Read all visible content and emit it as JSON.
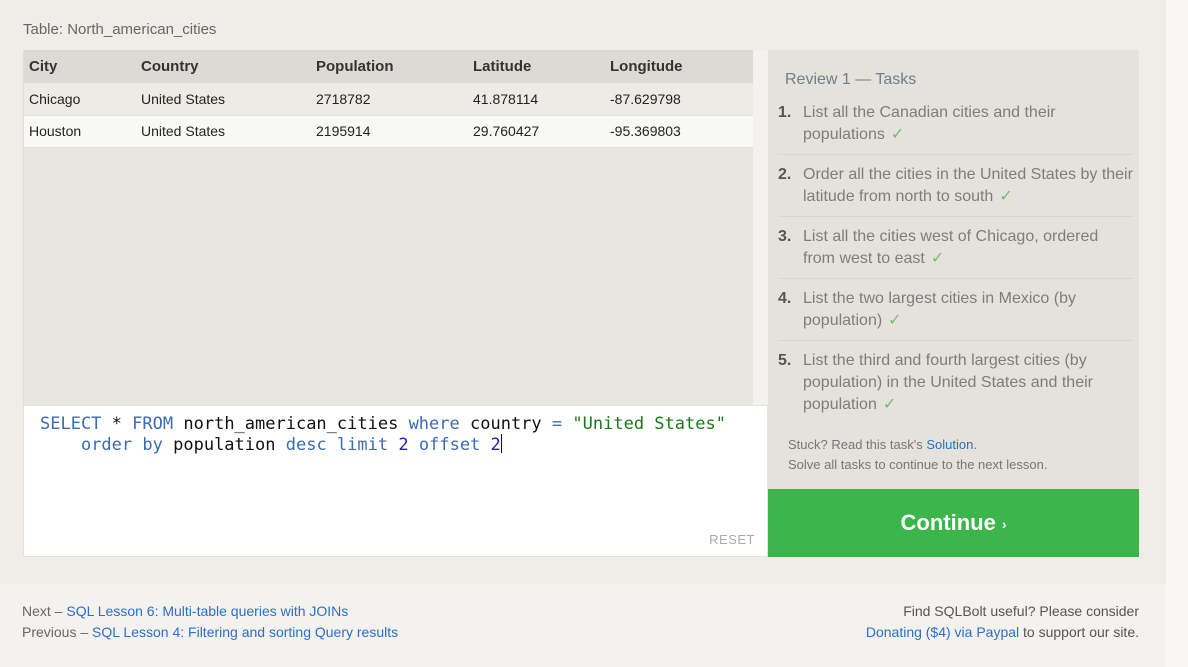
{
  "table": {
    "label": "Table: North_american_cities",
    "columns": [
      "City",
      "Country",
      "Population",
      "Latitude",
      "Longitude"
    ],
    "rows": [
      [
        "Chicago",
        "United States",
        "2718782",
        "41.878114",
        "-87.629798"
      ],
      [
        "Houston",
        "United States",
        "2195914",
        "29.760427",
        "-95.369803"
      ]
    ]
  },
  "editor": {
    "line1": {
      "kw_select": "SELECT",
      "star": "*",
      "kw_from": "FROM",
      "table": "north_american_cities",
      "kw_where": "where",
      "col": "country",
      "eq": "=",
      "value": "\"United States\""
    },
    "line2": {
      "kw_order": "order",
      "kw_by": "by",
      "col": "population",
      "kw_desc": "desc",
      "kw_limit": "limit",
      "limit": "2",
      "kw_offset": "offset",
      "offset": "2"
    },
    "reset_label": "RESET"
  },
  "tasks": {
    "title": "Review 1 — Tasks",
    "check": "✓",
    "items": [
      {
        "num": "1.",
        "text": "List all the Canadian cities and their populations"
      },
      {
        "num": "2.",
        "text": "Order all the cities in the United States by their latitude from north to south"
      },
      {
        "num": "3.",
        "text": "List all the cities west of Chicago, ordered from west to east"
      },
      {
        "num": "4.",
        "text": "List the two largest cities in Mexico (by population)"
      },
      {
        "num": "5.",
        "text": "List the third and fourth largest cities (by population) in the United States and their population"
      }
    ],
    "stuck_prefix": "Stuck? Read this task's ",
    "stuck_link": "Solution",
    "stuck_suffix": ".",
    "solve_note": "Solve all tasks to continue to the next lesson."
  },
  "continue_label": "Continue",
  "continue_chevron": "›",
  "footer": {
    "next_prefix": "Next – ",
    "next_link": "SQL Lesson 6: Multi-table queries with JOINs",
    "prev_prefix": "Previous – ",
    "prev_link": "SQL Lesson 4: Filtering and sorting Query results",
    "donate_line1": "Find SQLBolt useful? Please consider",
    "donate_link": "Donating ($4) via Paypal",
    "donate_suffix": " to support our site."
  }
}
